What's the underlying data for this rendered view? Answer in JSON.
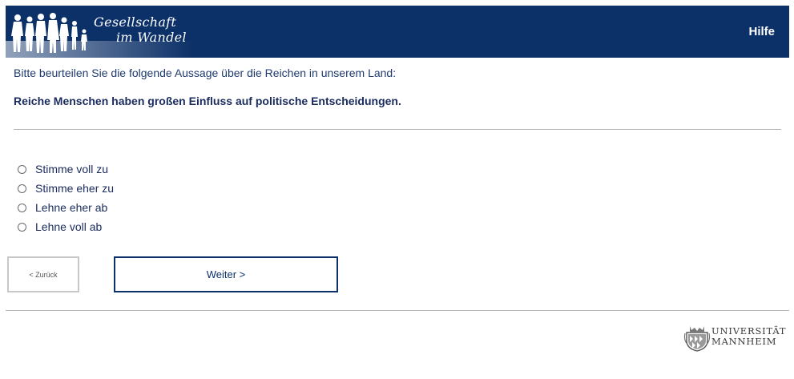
{
  "header": {
    "logo_line1": "Gesellschaft",
    "logo_line2": "im Wandel",
    "help_label": "Hilfe",
    "color": "#0c3068"
  },
  "survey": {
    "intro": "Bitte beurteilen Sie die folgende Aussage über die Reichen in unserem Land:",
    "question": "Reiche Menschen haben großen Einfluss auf politische Entscheidungen.",
    "options": [
      "Stimme voll zu",
      "Stimme eher zu",
      "Lehne eher ab",
      "Lehne voll ab"
    ]
  },
  "nav": {
    "back_label": "< Zurück",
    "next_label": "Weiter >"
  },
  "footer": {
    "uni_line1": "UNIVERSITÄT",
    "uni_line2": "MANNHEIM"
  }
}
